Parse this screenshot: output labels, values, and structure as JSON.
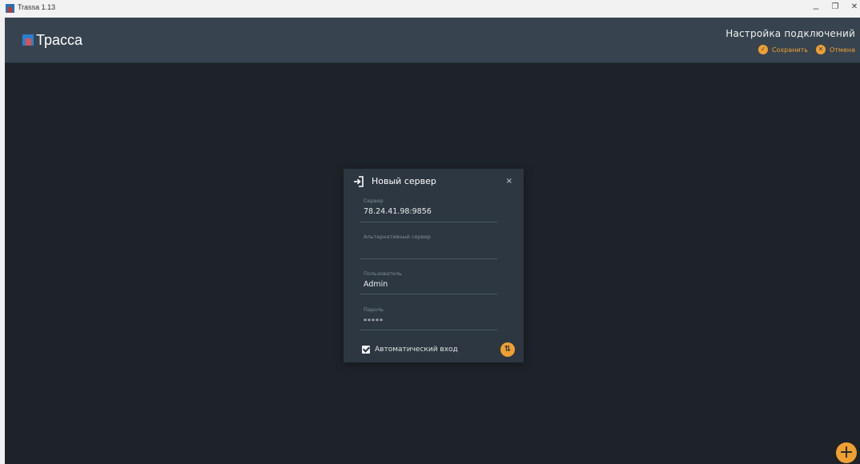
{
  "window": {
    "title": "Trassa 1.13",
    "minimize": "–",
    "restore": "❐",
    "close": "✕"
  },
  "header": {
    "logo_text": "Трасса",
    "title": "Настройка подключений",
    "save_label": "Сохранить",
    "cancel_label": "Отмена",
    "save_icon": "check-circle-icon",
    "cancel_icon": "x-circle-icon"
  },
  "dialog": {
    "title": "Новый сервер",
    "close": "×",
    "fields": [
      {
        "label": "Сервер",
        "value": "78.24.41.98:9856"
      },
      {
        "label": "Альтернативный сервер",
        "value": ""
      },
      {
        "label": "Пользователь",
        "value": "Admin"
      },
      {
        "label": "Пароль",
        "value": "*****"
      }
    ],
    "auto_login_label": "Автоматический вход",
    "auto_login_checked": true
  },
  "colors": {
    "accent": "#f0a030",
    "header_bg": "#37444f",
    "app_bg": "#1e2329",
    "dialog_bg": "#2c3741"
  }
}
